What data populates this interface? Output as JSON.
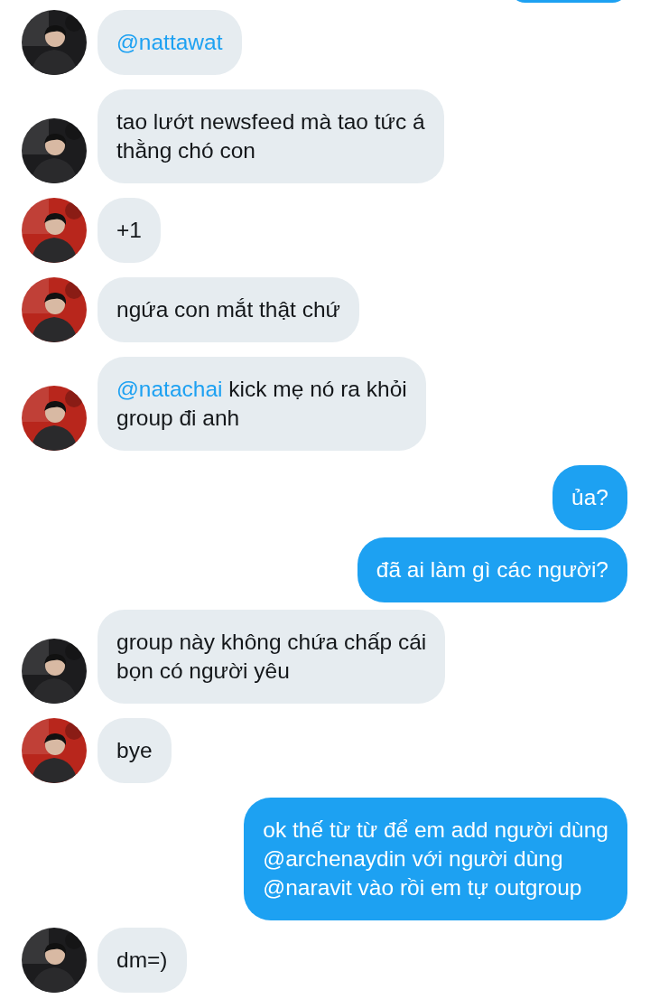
{
  "messages": [
    {
      "from_me": true,
      "kind": "cut"
    },
    {
      "from_me": false,
      "color": "#1c1c1e",
      "parts": [
        {
          "text": "@nattawat",
          "mention": true
        }
      ]
    },
    {
      "from_me": false,
      "color": "#1c1c1e",
      "parts": [
        {
          "text": "tao lướt newsfeed mà tao tức á\nthằng chó con"
        }
      ]
    },
    {
      "from_me": false,
      "color": "#b8261c",
      "parts": [
        {
          "text": "+1"
        }
      ]
    },
    {
      "from_me": false,
      "color": "#b8261c",
      "parts": [
        {
          "text": "ngứa con mắt thật chứ"
        }
      ]
    },
    {
      "from_me": false,
      "color": "#b8261c",
      "parts": [
        {
          "text": "@natachai",
          "mention": true
        },
        {
          "text": " kick mẹ nó ra khỏi\ngroup đi anh"
        }
      ]
    },
    {
      "from_me": true,
      "parts": [
        {
          "text": "ủa?"
        }
      ]
    },
    {
      "from_me": true,
      "parts": [
        {
          "text": "đã ai làm gì các người?"
        }
      ]
    },
    {
      "from_me": false,
      "color": "#1c1c1e",
      "parts": [
        {
          "text": "group này không chứa chấp cái\nbọn có người yêu"
        }
      ]
    },
    {
      "from_me": false,
      "color": "#b8261c",
      "parts": [
        {
          "text": "bye"
        }
      ]
    },
    {
      "from_me": true,
      "parts": [
        {
          "text": "ok thế từ từ để em add người dùng\n@archenaydin với người dùng\n@naravit vào rồi em tự outgroup"
        }
      ]
    },
    {
      "from_me": false,
      "color": "#1c1c1e",
      "parts": [
        {
          "text": "dm=)"
        }
      ]
    }
  ]
}
